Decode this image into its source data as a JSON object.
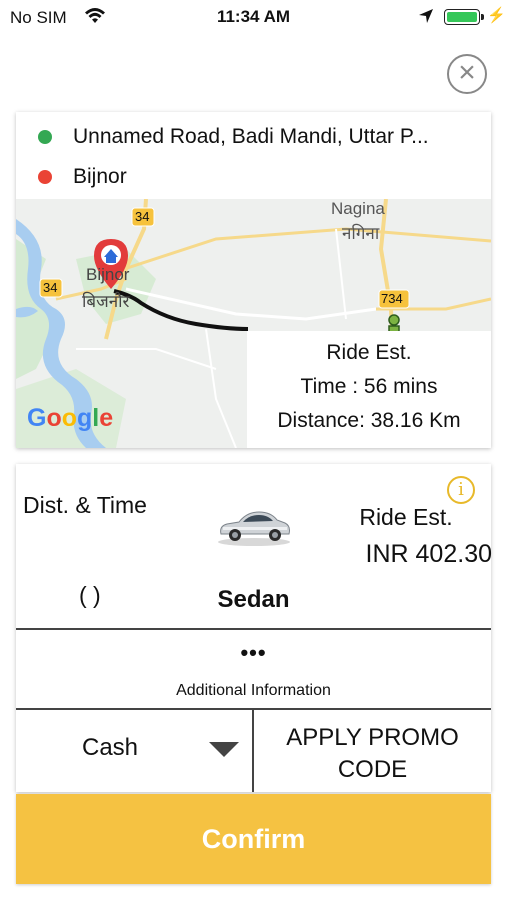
{
  "status_bar": {
    "carrier": "No SIM",
    "time": "11:34 AM",
    "battery_color": "#35c759"
  },
  "close_icon": "close-icon",
  "route": {
    "pickup": "Unnamed Road, Badi Mandi, Uttar P...",
    "pickup_color": "#34a853",
    "dropoff": "Bijnor",
    "dropoff_color": "#ea4335"
  },
  "map": {
    "labels": {
      "nagina_en": "Nagina",
      "nagina_hi": "नगिना",
      "bijnor_en": "Bijnor",
      "bijnor_hi": "बिजनौर",
      "road_34_a": "34",
      "road_34_b": "34",
      "road_734": "734"
    },
    "ride_est": {
      "title": "Ride Est.",
      "time": "Time : 56 mins",
      "distance": "Distance: 38.16 Km"
    },
    "attribution": "Google"
  },
  "details": {
    "dist_time_label": "Dist. & Time",
    "dist_time_value": "( )",
    "vehicle": "Sedan",
    "ride_est_label": "Ride Est.",
    "ride_est_value": "INR 402.30",
    "more": "•••",
    "additional_info": "Additional Information",
    "payment": "Cash",
    "promo": "APPLY PROMO CODE"
  },
  "confirm_label": "Confirm",
  "accent_color": "#f5c242"
}
